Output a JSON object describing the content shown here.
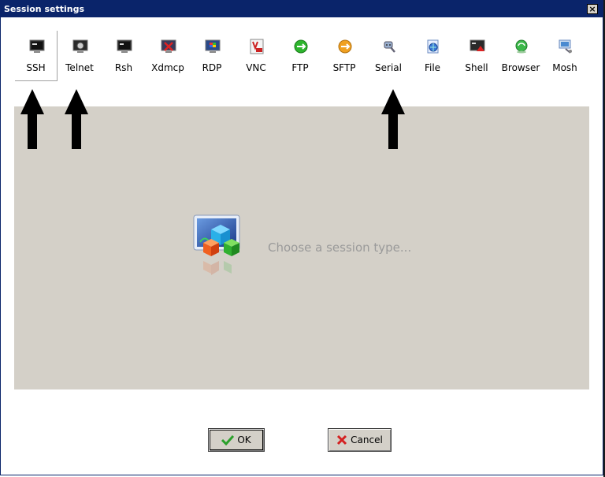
{
  "window": {
    "title": "Session settings",
    "close_label": "×"
  },
  "toolbar": {
    "items": [
      {
        "label": "SSH",
        "icon": "ssh-icon"
      },
      {
        "label": "Telnet",
        "icon": "telnet-icon"
      },
      {
        "label": "Rsh",
        "icon": "rsh-icon"
      },
      {
        "label": "Xdmcp",
        "icon": "xdmcp-icon"
      },
      {
        "label": "RDP",
        "icon": "rdp-icon"
      },
      {
        "label": "VNC",
        "icon": "vnc-icon"
      },
      {
        "label": "FTP",
        "icon": "ftp-icon"
      },
      {
        "label": "SFTP",
        "icon": "sftp-icon"
      },
      {
        "label": "Serial",
        "icon": "serial-icon"
      },
      {
        "label": "File",
        "icon": "file-icon"
      },
      {
        "label": "Shell",
        "icon": "shell-icon"
      },
      {
        "label": "Browser",
        "icon": "browser-icon"
      },
      {
        "label": "Mosh",
        "icon": "mosh-icon"
      }
    ]
  },
  "panel": {
    "hint": "Choose a session type..."
  },
  "buttons": {
    "ok_label": "OK",
    "cancel_label": "Cancel"
  },
  "colors": {
    "titlebar": "#0a246a",
    "panel": "#d4d0c8",
    "hint": "#9a9a9a"
  }
}
